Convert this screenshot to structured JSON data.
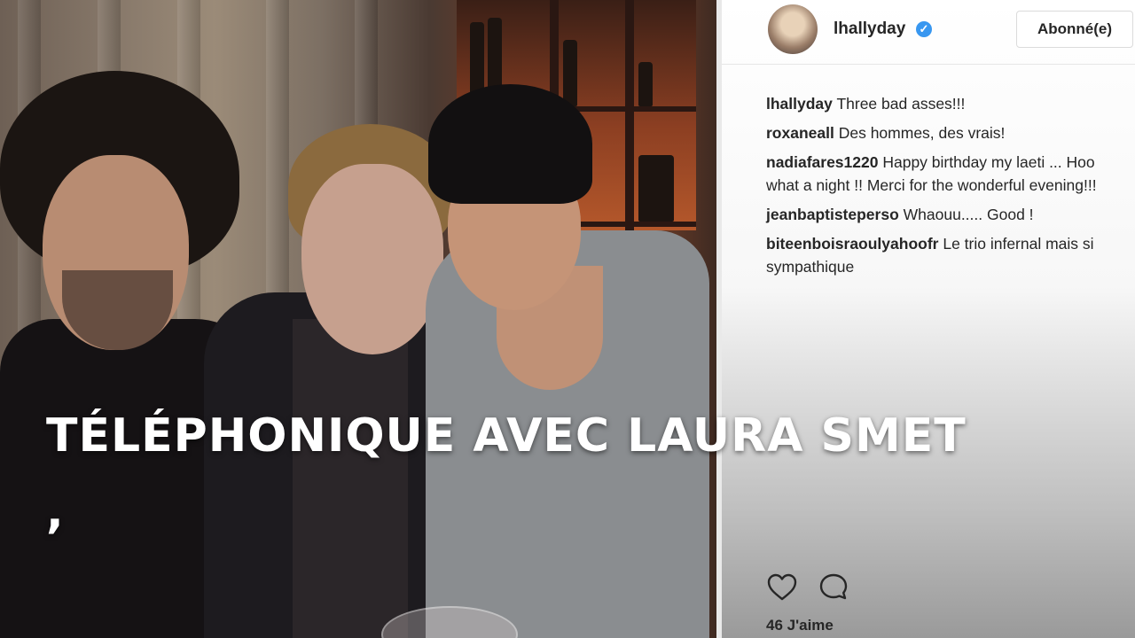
{
  "post": {
    "username": "lhallyday",
    "follow_label": "Abonné(e)",
    "likes_text": "46 J'aime"
  },
  "comments": [
    {
      "user": "lhallyday",
      "text": " Three bad asses!!!"
    },
    {
      "user": "roxaneall",
      "text": " Des hommes, des vrais!"
    },
    {
      "user": "nadiafares1220",
      "text": " Happy birthday my laeti ... Hoo what a night !! Merci for the wonderful evening!!!"
    },
    {
      "user": "jeanbaptisteperso",
      "text": " Whaouu..... Good !"
    },
    {
      "user": "biteenboisraoulyahoofr",
      "text": " Le trio infernal mais si sympathique"
    }
  ],
  "icons": {
    "verified": "verified-badge-icon",
    "like": "heart-icon",
    "comment": "comment-bubble-icon"
  },
  "overlay": {
    "caption_line1": "TÉLÉPHONIQUE AVEC LAURA SMET",
    "caption_line2": ","
  },
  "colors": {
    "verified_blue": "#3897f0",
    "text": "#262626",
    "caption": "#ffffff"
  }
}
